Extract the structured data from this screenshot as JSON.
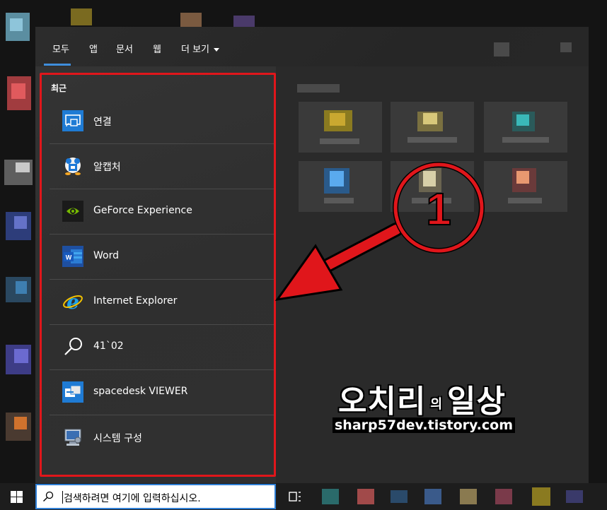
{
  "tabs": [
    {
      "label": "모두",
      "selected": true
    },
    {
      "label": "앱"
    },
    {
      "label": "문서"
    },
    {
      "label": "웹"
    },
    {
      "label": "더 보기"
    }
  ],
  "recent": {
    "title": "최근",
    "items": [
      {
        "label": "연결",
        "icon": "connect-icon"
      },
      {
        "label": "알캡처",
        "icon": "alcapture-icon"
      },
      {
        "label": "GeForce Experience",
        "icon": "nvidia-icon"
      },
      {
        "label": "Word",
        "icon": "word-icon"
      },
      {
        "label": "Internet Explorer",
        "icon": "ie-icon"
      },
      {
        "label": "41`02",
        "icon": "search-icon"
      },
      {
        "label": "spacedesk VIEWER",
        "icon": "spacedesk-icon"
      },
      {
        "label": "시스템 구성",
        "icon": "msconfig-icon"
      }
    ]
  },
  "annotation": {
    "number": "1",
    "color": "#e0161b"
  },
  "watermark": {
    "title_main": "오치리",
    "title_particle": "의",
    "title_end": "일상",
    "url": "sharp57dev.tistory.com"
  },
  "taskbar": {
    "search_placeholder": "검색하려면 여기에 입력하십시오."
  },
  "colors": {
    "accent": "#3f8edc",
    "highlight": "#e0161b"
  }
}
